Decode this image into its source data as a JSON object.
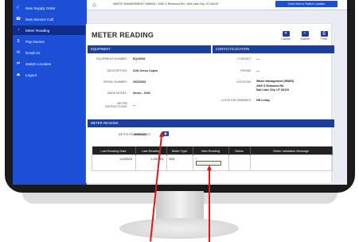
{
  "sidebar": {
    "items": [
      {
        "label": "New Supply Order",
        "icon": "cart-icon"
      },
      {
        "label": "New Service Call",
        "icon": "phone-icon"
      },
      {
        "label": "Meter Reading",
        "icon": "meter-icon"
      },
      {
        "label": "Pay Invoice",
        "icon": "money-icon"
      },
      {
        "label": "Email Us",
        "icon": "mail-icon"
      },
      {
        "label": "Switch Location",
        "icon": "swap-icon"
      },
      {
        "label": "Logout",
        "icon": "logout-icon"
      }
    ],
    "active_index": 2
  },
  "header": {
    "address": "WASTE MANAGEMENT (WM00) • 3060 S Redwood Rd • Salt Lake City, UT 84119",
    "switch_button": "Click Here to Switch Location"
  },
  "page": {
    "title": "METER READING",
    "toolbar": {
      "cancel": "Cancel",
      "submit": "Submit",
      "print": "Print"
    }
  },
  "equipment": {
    "section_title": "EQUIPMENT",
    "fields": [
      {
        "label": "EQUIPMENT NUMBER:",
        "value": "EQ10054"
      },
      {
        "label": "DESCRIPTION:",
        "value": "6191 Xerox Copier"
      },
      {
        "label": "SERIAL NUMBER:",
        "value": "20ZZ6334"
      },
      {
        "label": "MAKE MODEL:",
        "value": "Xerox – 6191"
      },
      {
        "label": "METER INSTRUCTIONS:",
        "value": "—"
      }
    ]
  },
  "contact": {
    "section_title": "CONTACT/LOCATION",
    "fields": [
      {
        "label": "CONTACT:",
        "value": "—"
      },
      {
        "label": "PHONE:",
        "value": "—"
      },
      {
        "label": "LOCATION:",
        "value": "Waste Management (WM00)\n3060 S Redwood Rd\nSalt Lake City, UT 84119"
      },
      {
        "label": "LOCATION REMARKS:",
        "value": "HR Lobby"
      }
    ]
  },
  "meter_reading": {
    "section_title": "METER READING",
    "date_label": "METER READING DATE:",
    "date_value": "2/23/2021",
    "columns": [
      "Last Reading Date",
      "Last Reading",
      "Meter Type",
      "New Reading",
      "Status",
      "Meter Validation Message"
    ],
    "rows": [
      {
        "last_date": "1/13/2021",
        "last_reading": "1,000,001",
        "meter_type": "B/W",
        "new_reading_marker": "*",
        "status": "",
        "message": ""
      }
    ]
  },
  "colors": {
    "brand_blue": "#1c4fd6",
    "section_blue": "#1c3f9e",
    "arrow_red": "#e01818"
  }
}
